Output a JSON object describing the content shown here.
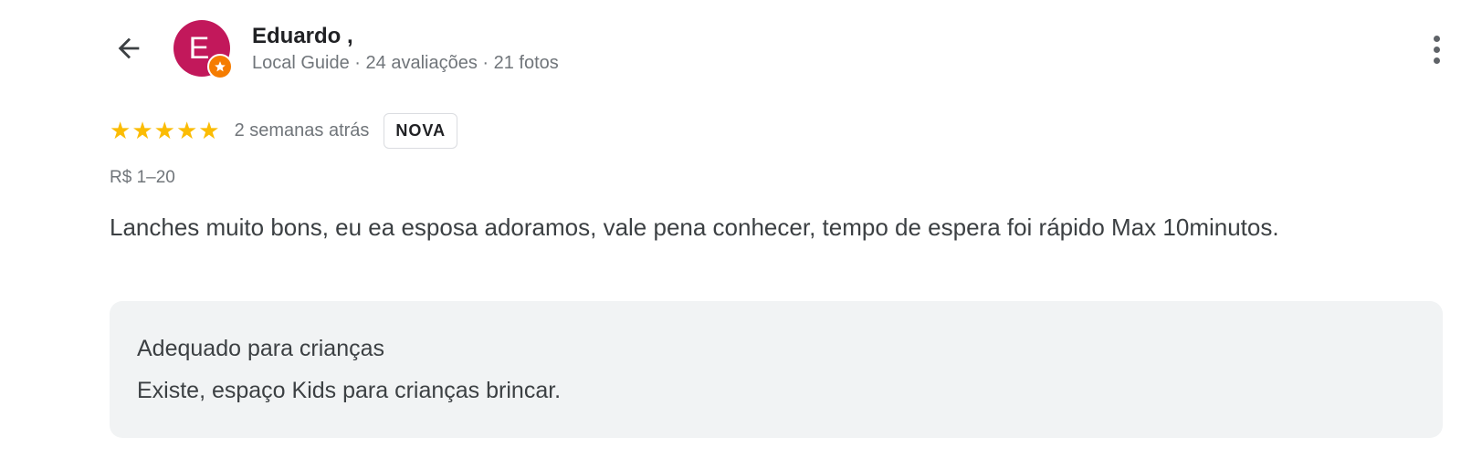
{
  "header": {
    "back_icon": "arrow-left-icon",
    "avatar_letter": "E",
    "avatar_color": "#c2185b",
    "guide_badge_icon": "star-badge-icon",
    "reviewer_name": "Eduardo ,",
    "meta": {
      "guide_label": "Local Guide",
      "separator": " · ",
      "reviews": "24 avaliações",
      "photos": "21 fotos"
    },
    "more_icon": "more-vert-icon"
  },
  "review": {
    "rating": 5,
    "rating_max": 5,
    "star_color": "#fbbc04",
    "time_ago": "2 semanas atrás",
    "badge": "NOVA",
    "price_range": "R$ 1–20",
    "text": "Lanches muito bons, eu ea esposa adoramos, vale pena conhecer, tempo de espera foi rápido Max 10minutos.",
    "attribute": {
      "title": "Adequado para crianças",
      "value": "Existe, espaço Kids para crianças brincar."
    }
  }
}
